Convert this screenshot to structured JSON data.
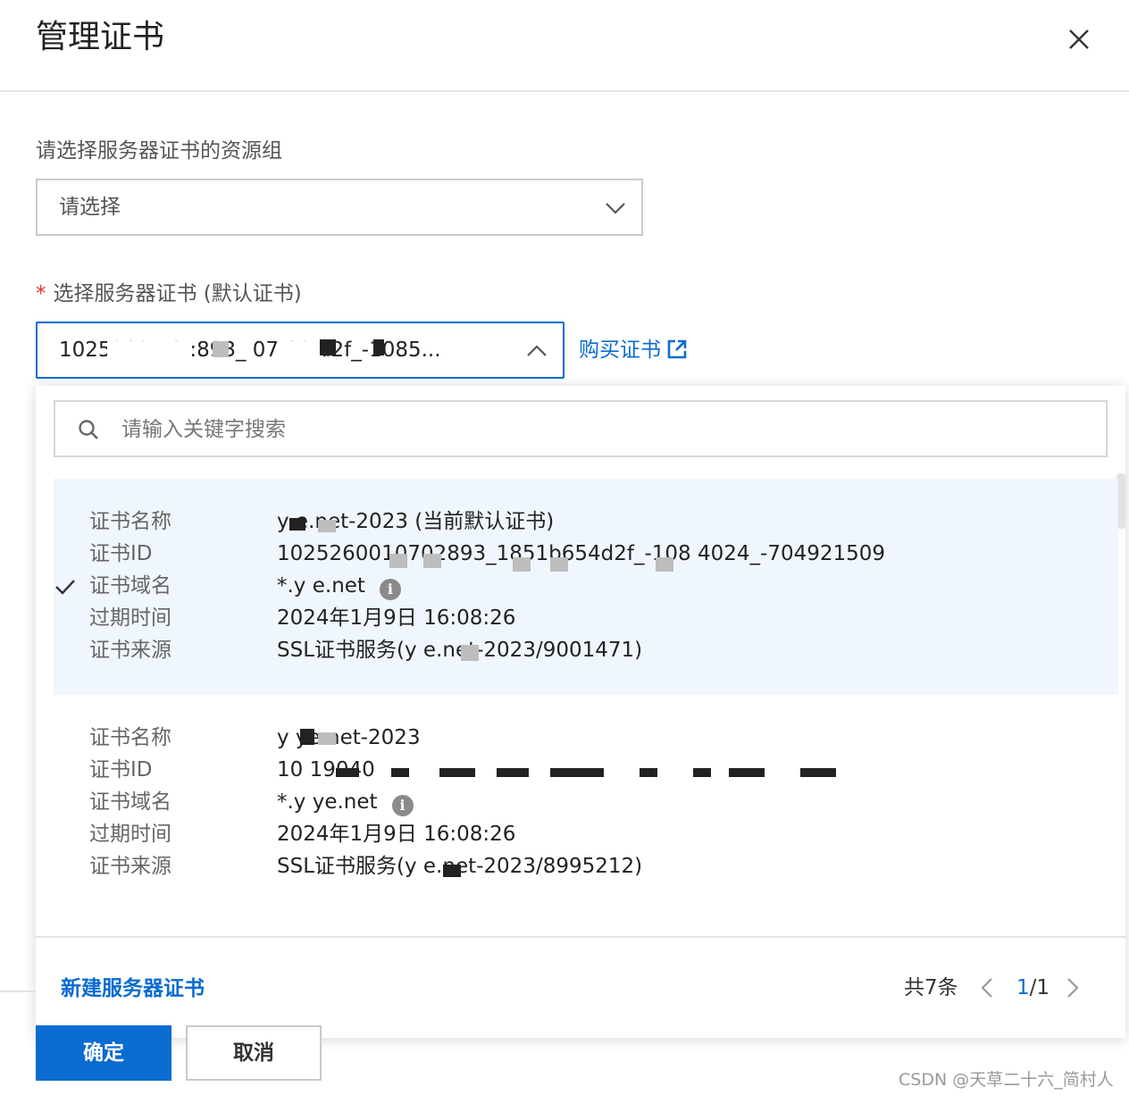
{
  "dialog": {
    "title": "管理证书"
  },
  "resource_group": {
    "label": "请选择服务器证书的资源组",
    "placeholder": "请选择"
  },
  "server_cert": {
    "required_mark": "*",
    "label": "选择服务器证书 (默认证书)",
    "selected_value": "10252021 9     :893_ 07  00   d2f_-1085...",
    "buy_link": "购买证书"
  },
  "dropdown": {
    "search_placeholder": "请输入关键字搜索",
    "items": [
      {
        "selected": true,
        "name_label": "证书名称",
        "name_value": "y   e.net-2023 (当前默认证书)",
        "id_label": "证书ID",
        "id_value": "1025260010702893_1851b654d2f_-108    4024_-704921509",
        "domain_label": "证书域名",
        "domain_value": "*.y     e.net",
        "expire_label": "过期时间",
        "expire_value": "2024年1月9日 16:08:26",
        "source_label": "证书来源",
        "source_value": "SSL证书服务(y      e.net-2023/9001471)"
      },
      {
        "selected": false,
        "name_label": "证书名称",
        "name_value": "y     ye.net-2023",
        "id_label": "证书ID",
        "id_value": "10                                          19040",
        "domain_label": "证书域名",
        "domain_value": "*.y     ye.net",
        "expire_label": "过期时间",
        "expire_value": "2024年1月9日 16:08:26",
        "source_label": "证书来源",
        "source_value": "SSL证书服务(y      e.net-2023/8995212)"
      }
    ],
    "new_cert_link": "新建服务器证书",
    "pagination": {
      "total": "共7条",
      "current": "1",
      "separator": "/",
      "pages": "1"
    }
  },
  "buttons": {
    "ok": "确定",
    "cancel": "取消"
  },
  "watermark": "CSDN @天草二十六_简村人",
  "colors": {
    "primary": "#0a6bd1",
    "selected_bg": "#f0f6fd",
    "required": "#e0322b",
    "border": "#c9c9c9"
  },
  "icons": {
    "close": "close-icon",
    "chevron_down": "chevron-down-icon",
    "chevron_up": "chevron-up-icon",
    "external": "external-link-icon",
    "search": "search-icon",
    "check": "check-icon",
    "info": "info-icon"
  }
}
